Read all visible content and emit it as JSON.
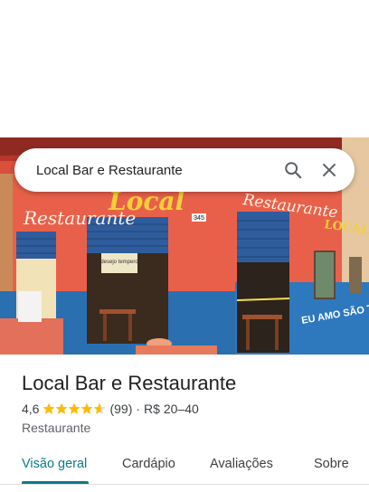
{
  "search": {
    "value": "Local Bar e Restaurante"
  },
  "place": {
    "name": "Local Bar e Restaurante",
    "rating": "4,6",
    "reviews": "(99)",
    "separator": "·",
    "price": "R$ 20–40",
    "category": "Restaurante",
    "stars_value": 4.6
  },
  "photo": {
    "sign_left": "Restaurante",
    "sign_center": "Local",
    "sign_right": "Restaurante",
    "sign_right_2": "LOCAL",
    "number": "345",
    "wall_text": "EU AMO SÃO TIAGO",
    "inner_sign": "desejo tempero"
  },
  "tabs": [
    {
      "label": "Visão geral",
      "active": true
    },
    {
      "label": "Cardápio",
      "active": false
    },
    {
      "label": "Avaliações",
      "active": false
    },
    {
      "label": "Sobre",
      "active": false
    }
  ],
  "colors": {
    "accent": "#0b7b87",
    "star": "#fbbc04",
    "wall": "#e8533f",
    "shutter": "#2f5c9c"
  }
}
